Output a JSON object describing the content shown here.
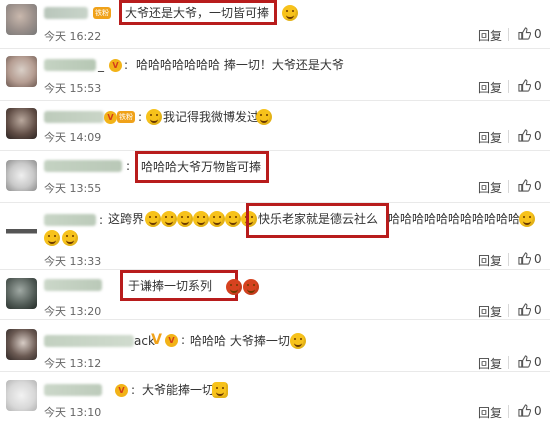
{
  "reply_label": "回复",
  "like_count": "0",
  "colors": {
    "highlight": "#b81c1c",
    "badge": "#f0a21a",
    "vip": "#f2b318"
  },
  "comments": [
    {
      "time": "今天 16:22",
      "text": "大爷还是大爷，一切皆可捧",
      "badge": "铁粉"
    },
    {
      "time": "今天 15:53",
      "text": "哈哈哈哈哈哈哈  捧一切！大爷还是大爷",
      "name_tail": "_"
    },
    {
      "time": "今天 14:09",
      "text": "我记得我微博发过",
      "badge": "铁粉"
    },
    {
      "time": "今天 13:55",
      "text": "哈哈哈大爷万物皆可捧"
    },
    {
      "time": "今天 13:33",
      "text_before": "这跨界",
      "text": "快乐老家就是德云社么",
      "text_after": "哈哈哈哈哈哈哈哈哈哈哈"
    },
    {
      "time": "今天 13:20",
      "text": "于谦捧一切系列"
    },
    {
      "time": "今天 13:12",
      "text": "哈哈哈 大爷捧一切",
      "name_tail": "ack"
    },
    {
      "time": "今天 13:10",
      "text": "大爷能捧一切"
    }
  ]
}
